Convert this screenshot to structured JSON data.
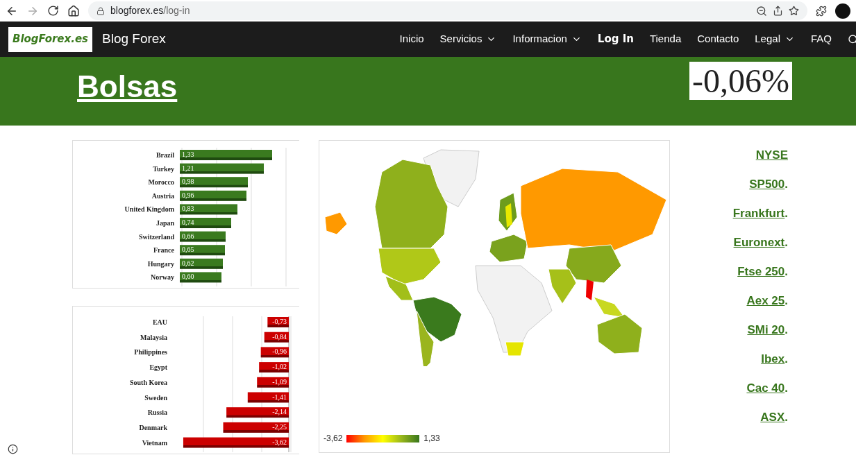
{
  "browser": {
    "url_host": "blogforex.es",
    "url_path": "/log-in"
  },
  "site": {
    "logo": "BlogForex.es",
    "title": "Blog Forex"
  },
  "nav": [
    {
      "label": "Inicio",
      "dropdown": false,
      "selected": false
    },
    {
      "label": "Servicios",
      "dropdown": true,
      "selected": false
    },
    {
      "label": "Informacion",
      "dropdown": true,
      "selected": false
    },
    {
      "label": "Log In",
      "dropdown": false,
      "selected": true
    },
    {
      "label": "Tienda",
      "dropdown": false,
      "selected": false
    },
    {
      "label": "Contacto",
      "dropdown": false,
      "selected": false
    },
    {
      "label": "Legal",
      "dropdown": true,
      "selected": false
    },
    {
      "label": "FAQ",
      "dropdown": false,
      "selected": false
    }
  ],
  "header": {
    "title": "Bolsas",
    "change": "-0,06%"
  },
  "gainers": {
    "chart_data": {
      "type": "bar",
      "orientation": "horizontal",
      "categories": [
        "Brazil",
        "Turkey",
        "Morocco",
        "Austria",
        "United Kingdom",
        "Japan",
        "Switzerland",
        "France",
        "Hungary",
        "Norway"
      ],
      "values": [
        1.33,
        1.21,
        0.98,
        0.96,
        0.83,
        0.74,
        0.66,
        0.65,
        0.62,
        0.6
      ],
      "value_labels": [
        "1,33",
        "1,21",
        "0,98",
        "0,96",
        "0,83",
        "0,74",
        "0,66",
        "0,65",
        "0,62",
        "0,60"
      ]
    }
  },
  "losers": {
    "chart_data": {
      "type": "bar",
      "orientation": "horizontal",
      "categories": [
        "EAU",
        "Malaysia",
        "Philippines",
        "Egypt",
        "South Korea",
        "Sweden",
        "Russia",
        "Denmark",
        "Vietnam"
      ],
      "values": [
        -0.73,
        -0.84,
        -0.96,
        -1.02,
        -1.09,
        -1.41,
        -2.14,
        -2.25,
        -3.62
      ],
      "value_labels": [
        "-0,73",
        "-0,84",
        "-0,96",
        "-1,02",
        "-1,09",
        "-1,41",
        "-2,14",
        "-2,25",
        "-3,62"
      ]
    }
  },
  "map": {
    "legend_min": "-3,62",
    "legend_max": "1,33"
  },
  "links": [
    {
      "label": "NYSE"
    },
    {
      "label": "SP500",
      "suffix": "."
    },
    {
      "label": "Frankfurt",
      "suffix": "."
    },
    {
      "label": "Euronext",
      "suffix": "."
    },
    {
      "label": "Ftse 250",
      "suffix": "."
    },
    {
      "label": "Aex 25",
      "suffix": "."
    },
    {
      "label": "SMi 20",
      "suffix": "."
    },
    {
      "label": "Ibex",
      "suffix": "."
    },
    {
      "label": "Cac 40",
      "suffix": "."
    },
    {
      "label": "ASX",
      "suffix": "."
    }
  ]
}
